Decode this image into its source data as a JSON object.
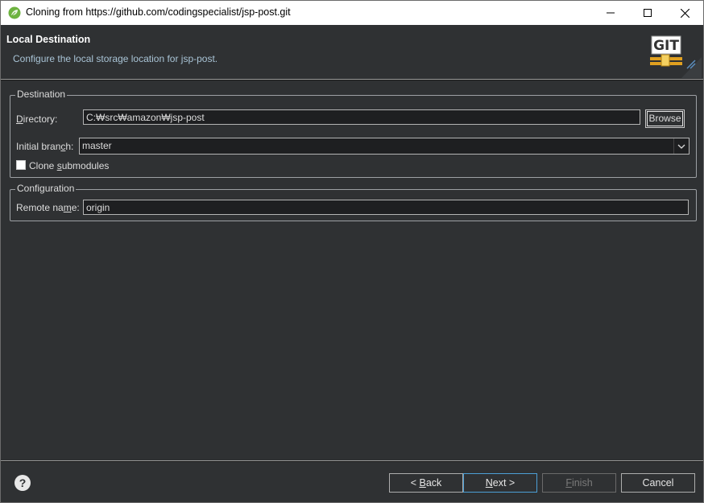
{
  "window": {
    "title": "Cloning from https://github.com/codingspecialist/jsp-post.git",
    "controls": [
      "minimize",
      "maximize",
      "close"
    ]
  },
  "header": {
    "title": "Local Destination",
    "description": "Configure the local storage location for jsp-post.",
    "logo_text": "GIT"
  },
  "destination": {
    "legend": "Destination",
    "directory_label_prefix": "D",
    "directory_label_rest": "irectory:",
    "directory_value": "C:₩src₩amazon₩jsp-post",
    "browse_label": "Browse",
    "initial_branch_label_a": "Initial bran",
    "initial_branch_label_u": "c",
    "initial_branch_label_b": "h:",
    "initial_branch_value": "master",
    "clone_submodules_label_a": "Clone ",
    "clone_submodules_label_u": "s",
    "clone_submodules_label_b": "ubmodules",
    "clone_submodules_checked": false
  },
  "configuration": {
    "legend": "Configuration",
    "remote_name_label_a": "Remote na",
    "remote_name_label_u": "m",
    "remote_name_label_b": "e:",
    "remote_name_value": "origin"
  },
  "footer": {
    "help_icon": "?",
    "back_label_pre": "< ",
    "back_label_u": "B",
    "back_label_post": "ack",
    "next_label_u": "N",
    "next_label_post": "ext >",
    "finish_label_u": "F",
    "finish_label_post": "inish",
    "cancel_label": "Cancel",
    "finish_enabled": false
  },
  "colors": {
    "background": "#2f3133",
    "accent": "#4c9fd6",
    "description_text": "#a9c4d6"
  }
}
